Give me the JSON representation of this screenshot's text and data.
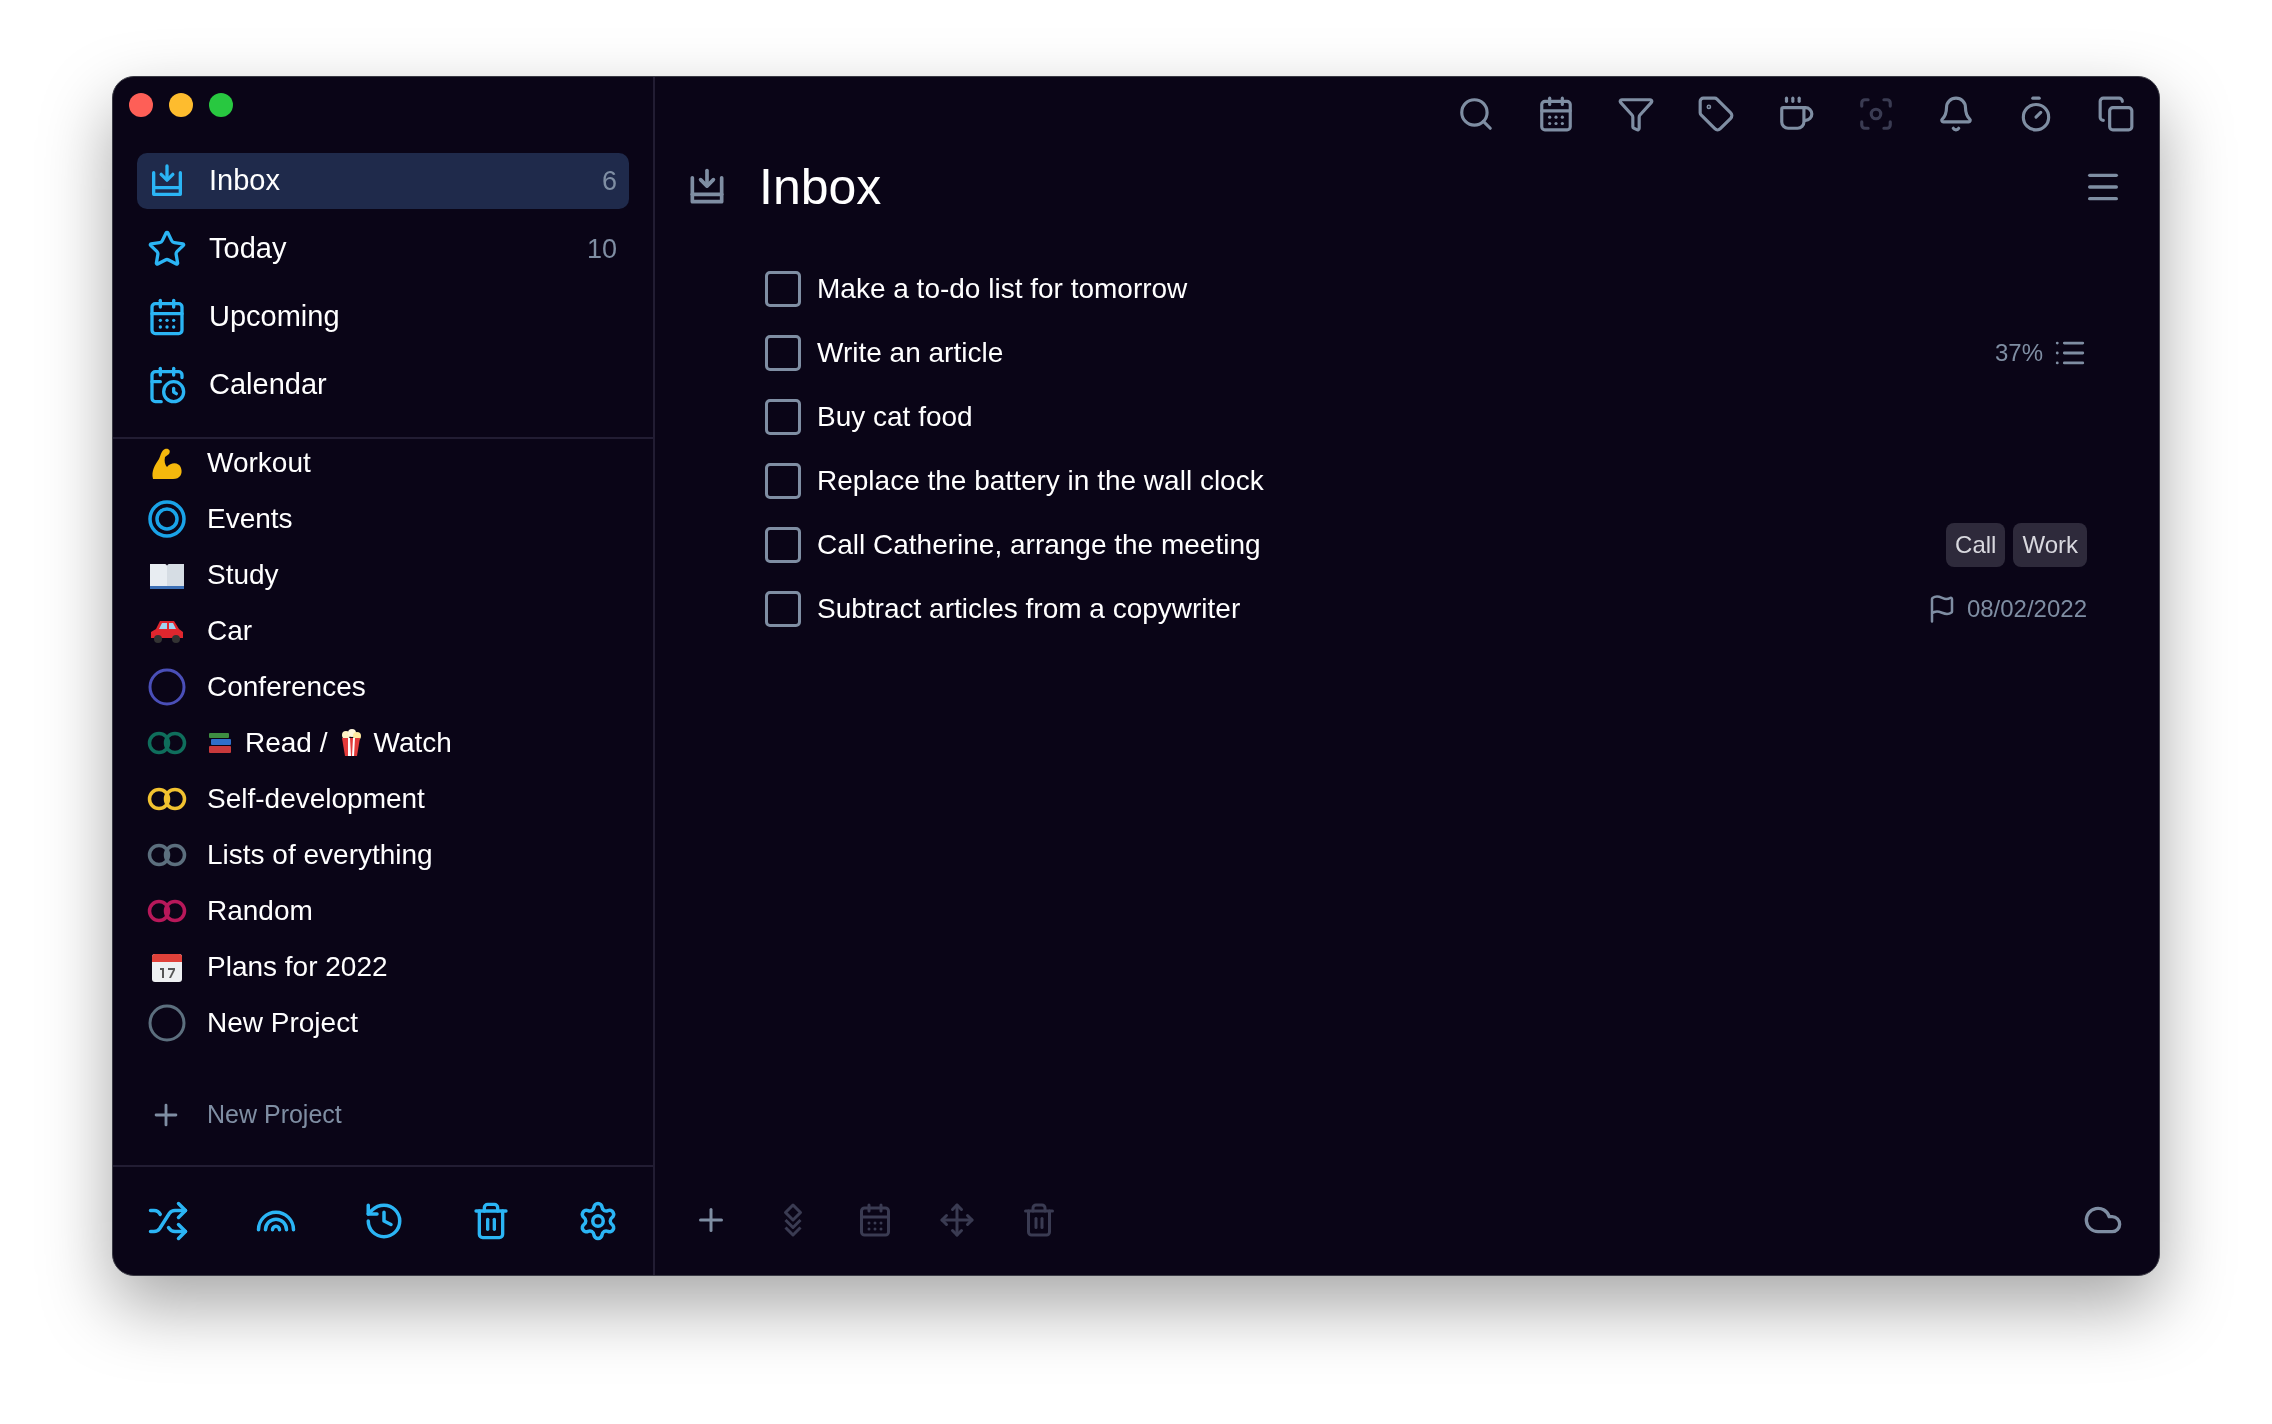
{
  "sidebar": {
    "nav": [
      {
        "kind": "inbox",
        "label": "Inbox",
        "count": "6",
        "selected": true
      },
      {
        "kind": "today",
        "label": "Today",
        "count": "10",
        "selected": false
      },
      {
        "kind": "upcoming",
        "label": "Upcoming",
        "selected": false
      },
      {
        "kind": "calendar",
        "label": "Calendar",
        "selected": false
      }
    ],
    "projects": [
      {
        "kind": "arm",
        "label": "Workout"
      },
      {
        "kind": "ring",
        "color": "#1aa3e8",
        "label": "Events"
      },
      {
        "kind": "book",
        "label": "Study"
      },
      {
        "kind": "car",
        "label": "Car"
      },
      {
        "kind": "circle",
        "color": "#4a4fb8",
        "label": "Conferences"
      },
      {
        "kind": "double-ring",
        "color": "#0f6e5c",
        "parts": [
          "Read /",
          "Watch"
        ]
      },
      {
        "kind": "double-ring",
        "color": "#f2c230",
        "label": "Self-development"
      },
      {
        "kind": "double-ring",
        "color": "#5c6f7e",
        "label": "Lists of everything"
      },
      {
        "kind": "double-ring",
        "color": "#b8185a",
        "label": "Random"
      },
      {
        "kind": "calendar-page",
        "label": "Plans for 2022"
      },
      {
        "kind": "circle",
        "color": "#5c6f7e",
        "label": "New Project"
      }
    ],
    "add_project": "New Project"
  },
  "toolbar": [
    {
      "kind": "search",
      "disabled": false
    },
    {
      "kind": "calendar",
      "disabled": false
    },
    {
      "kind": "filter",
      "disabled": false
    },
    {
      "kind": "tag",
      "disabled": false
    },
    {
      "kind": "cup",
      "disabled": false
    },
    {
      "kind": "focus",
      "disabled": true
    },
    {
      "kind": "bell",
      "disabled": false
    },
    {
      "kind": "timer",
      "disabled": false
    },
    {
      "kind": "copy",
      "disabled": false
    }
  ],
  "title": "Inbox",
  "tasks": [
    {
      "text": "Make a to-do list for tomorrow",
      "checked": false
    },
    {
      "text": "Write an article",
      "checked": false,
      "progress": "37%"
    },
    {
      "text": "Buy cat food",
      "checked": false
    },
    {
      "text": "Replace the battery in the wall clock",
      "checked": false
    },
    {
      "text": "Call Catherine, arrange the meeting",
      "checked": false,
      "tags": [
        "Call",
        "Work"
      ]
    },
    {
      "text": "Subtract articles from a copywriter",
      "checked": false,
      "due": "08/02/2022"
    }
  ],
  "bottom_bar": [
    {
      "kind": "add",
      "disabled": false
    },
    {
      "kind": "priority",
      "disabled": true
    },
    {
      "kind": "schedule",
      "disabled": true
    },
    {
      "kind": "move",
      "disabled": true
    },
    {
      "kind": "delete",
      "disabled": true
    }
  ]
}
